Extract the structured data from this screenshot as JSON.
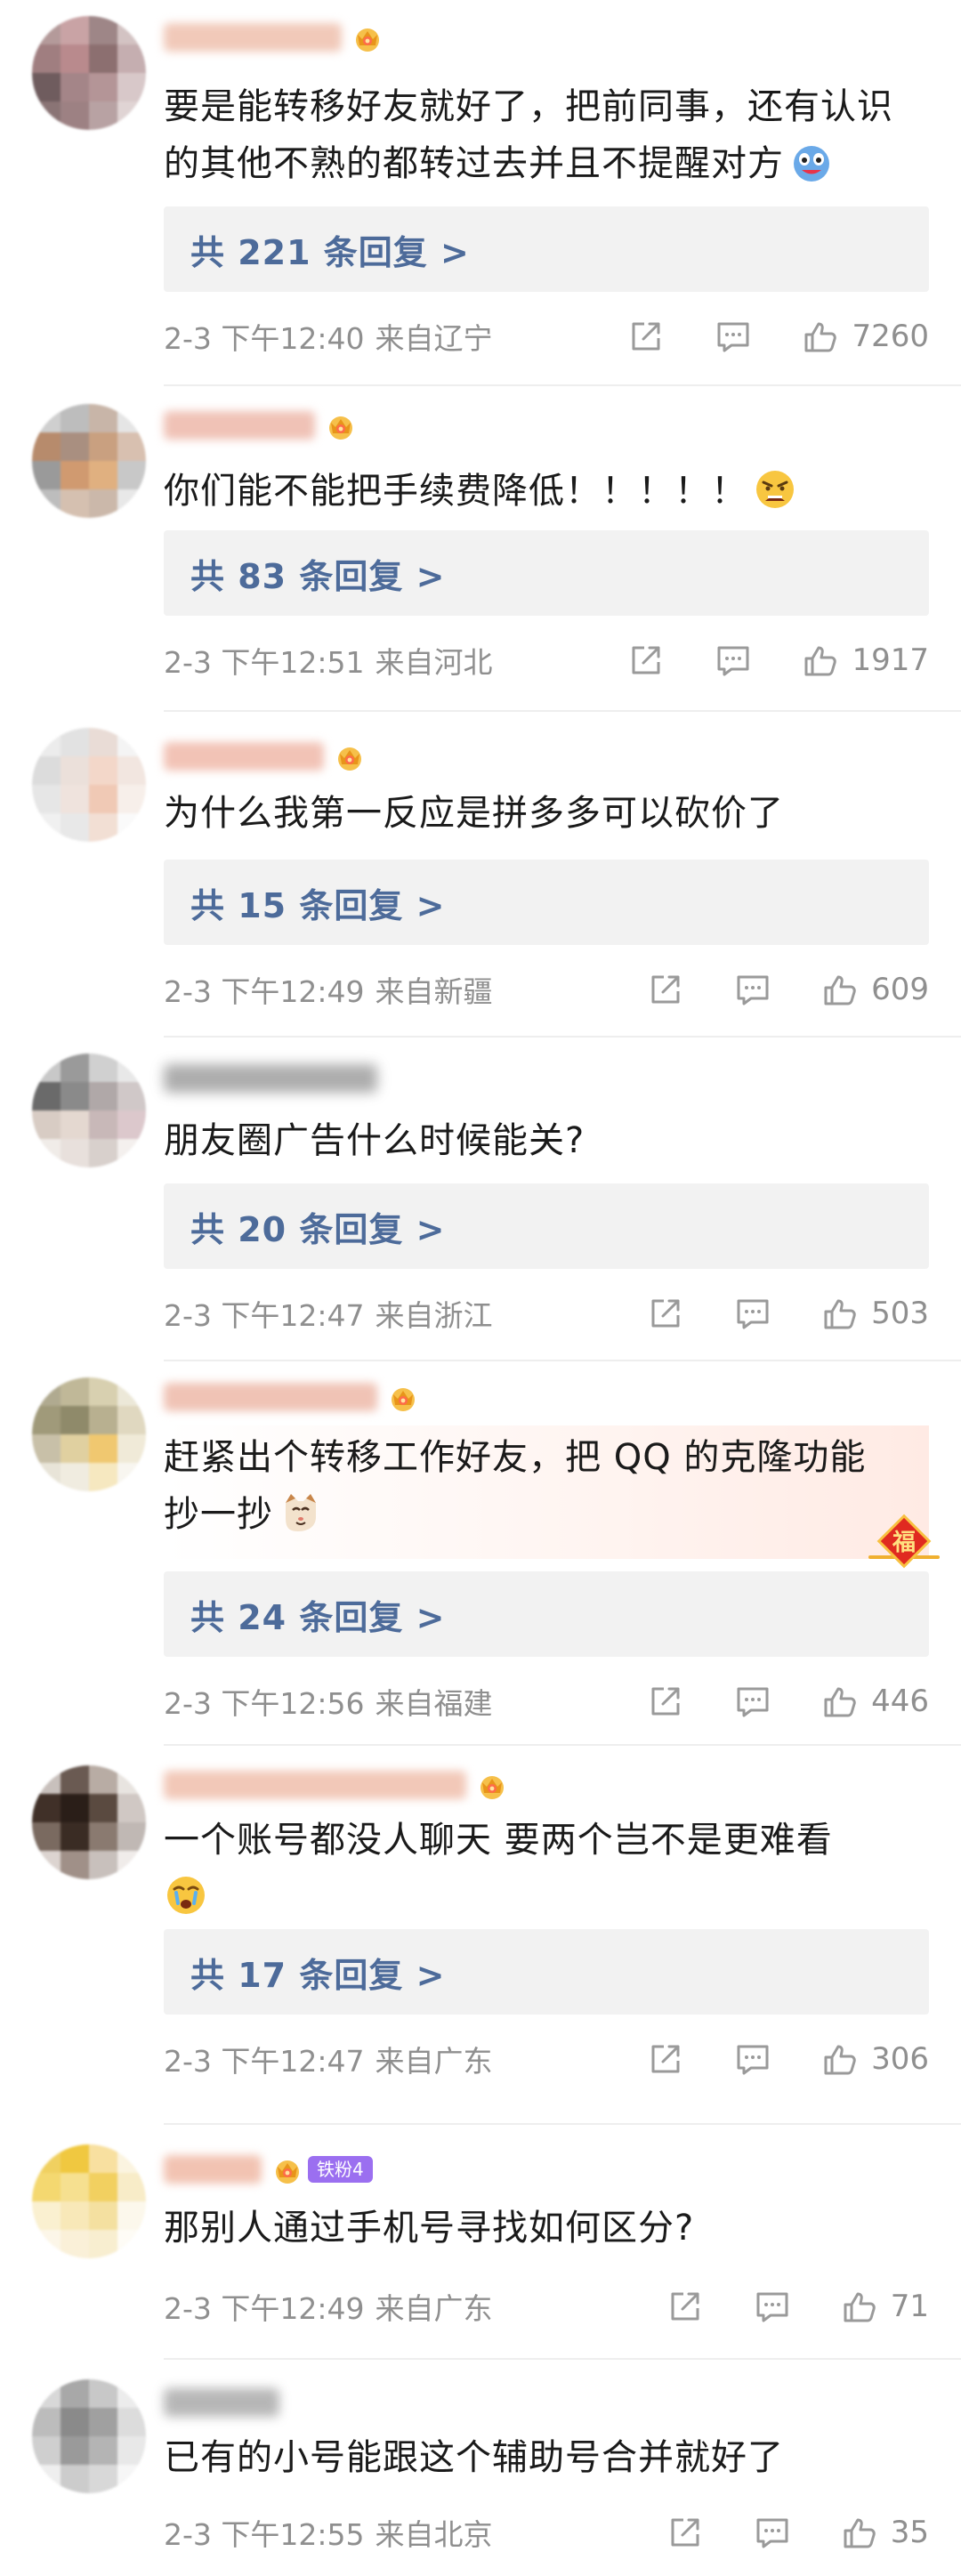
{
  "comments": [
    {
      "text": "要是能转移好友就好了，把前同事，还有认识的其他不熟的都转过去并且不提醒对方",
      "replies": "共 221 条回复 >",
      "time": "2-3 下午12:40",
      "location": "来自辽宁",
      "likes": "7260",
      "emoji": "monster-emoji"
    },
    {
      "text": "你们能不能把手续费降低！！！！！",
      "replies": "共 83 条回复 >",
      "time": "2-3 下午12:51",
      "location": "来自河北",
      "likes": "1917",
      "emoji": "angry-face-emoji"
    },
    {
      "text": "为什么我第一反应是拼多多可以砍价了",
      "replies": "共 15 条回复 >",
      "time": "2-3 下午12:49",
      "location": "来自新疆",
      "likes": "609"
    },
    {
      "text": "朋友圈广告什么时候能关?",
      "replies": "共 20 条回复 >",
      "time": "2-3 下午12:47",
      "location": "来自浙江",
      "likes": "503"
    },
    {
      "text_line1": "赶紧出个转移工作好友，把 QQ 的克隆功能",
      "text_line2": "抄一抄",
      "replies": "共 24 条回复 >",
      "time": "2-3 下午12:56",
      "location": "来自福建",
      "likes": "446",
      "emoji": "cat-face-emoji",
      "badge_text": "福"
    },
    {
      "text": "一个账号都没人聊天 要两个岂不是更难看",
      "replies": "共 17 条回复 >",
      "time": "2-3 下午12:47",
      "location": "来自广东",
      "likes": "306",
      "emoji": "cry-face-emoji"
    },
    {
      "text": "那别人通过手机号寻找如何区分?",
      "time": "2-3 下午12:49",
      "location": "来自广东",
      "likes": "71",
      "fan_badge": "铁粉4"
    },
    {
      "text": "已有的小号能跟这个辅助号合并就好了",
      "time": "2-3 下午12:55",
      "location": "来自北京",
      "likes": "35"
    }
  ],
  "icons": {
    "share": "share-icon",
    "comment": "comment-icon",
    "like": "thumbs-up-icon",
    "crown": "crown-badge-icon"
  },
  "colors": {
    "reply_link": "#4d6b9a",
    "meta_text": "#8f8f8f",
    "reply_bg": "#f2f2f2"
  }
}
